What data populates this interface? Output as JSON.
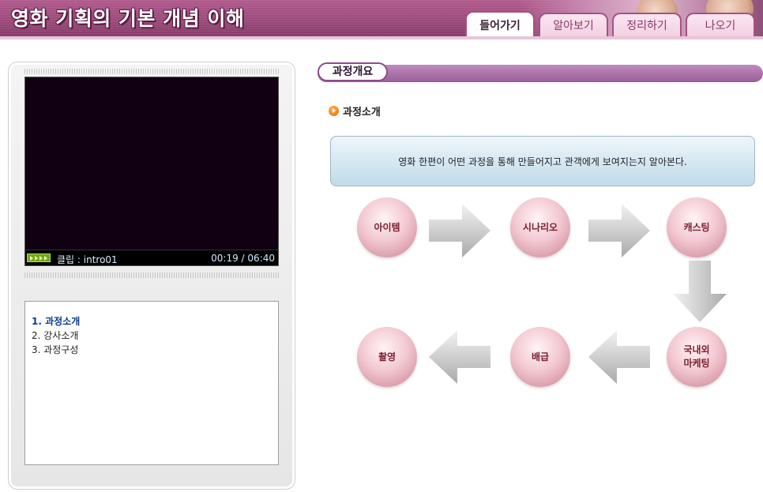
{
  "app": {
    "title": "영화 기획의 기본 개념 이해"
  },
  "tabs": [
    {
      "label": "들어가기",
      "active": true
    },
    {
      "label": "알아보기",
      "active": false
    },
    {
      "label": "정리하기",
      "active": false
    },
    {
      "label": "나오기",
      "active": false
    }
  ],
  "player": {
    "clip_label": "클립 : intro01",
    "time": "00:19 / 06:40"
  },
  "playlist": [
    {
      "label": "1. 과정소개",
      "active": true
    },
    {
      "label": "2. 강사소개",
      "active": false
    },
    {
      "label": "3. 과정구성",
      "active": false
    }
  ],
  "section": {
    "badge": "과정개요",
    "subtitle": "과정소개",
    "intro": "영화 한편이 어떤 과정을 통해 만들어지고 관객에게 보여지는지 알아본다."
  },
  "process": {
    "steps": [
      "아이템",
      "시나리오",
      "캐스팅",
      "국내외\n마케팅",
      "배급",
      "촬영"
    ]
  },
  "colors": {
    "header": "#9a4a7a",
    "tab_border": "#a8507f",
    "section_bar": "#9a5d98",
    "step_text": "#7a1f2e",
    "playlist_active": "#0b3a8f"
  }
}
